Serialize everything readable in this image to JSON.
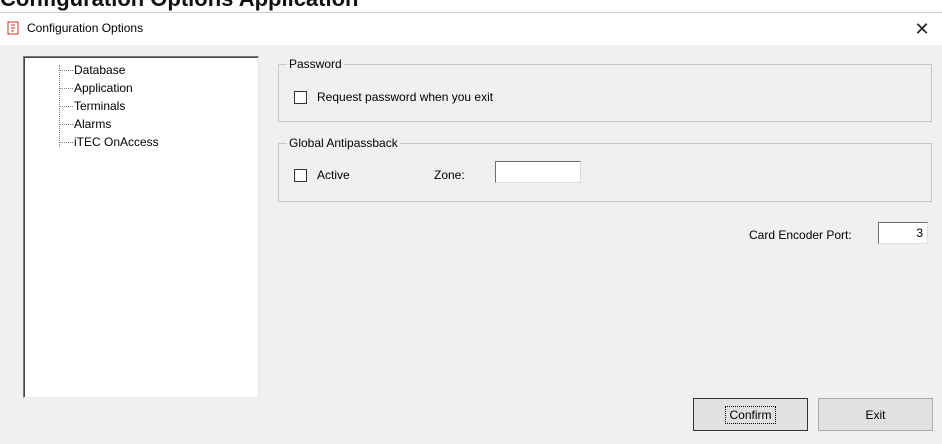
{
  "heading": {
    "text": "Configuration Options Application"
  },
  "window": {
    "title": "Configuration Options",
    "close_label": "✕"
  },
  "tree": {
    "items": [
      {
        "label": "Database"
      },
      {
        "label": "Application"
      },
      {
        "label": "Terminals"
      },
      {
        "label": "Alarms"
      },
      {
        "label": "iTEC OnAccess"
      }
    ]
  },
  "password_group": {
    "title": "Password",
    "checkbox_label": "Request password when you exit",
    "checked": false
  },
  "antipassback_group": {
    "title": "Global Antipassback",
    "active_label": "Active",
    "active_checked": false,
    "zone_label": "Zone:",
    "zone_value": ""
  },
  "card_encoder": {
    "label": "Card Encoder Port:",
    "value": "3"
  },
  "buttons": {
    "confirm": "Confirm",
    "exit": "Exit"
  },
  "colors": {
    "dialog_bg": "#f0f0f0",
    "titlebar_bg": "#ffffff",
    "button_bg": "#e1e1e1",
    "icon_red": "#c0392b"
  }
}
